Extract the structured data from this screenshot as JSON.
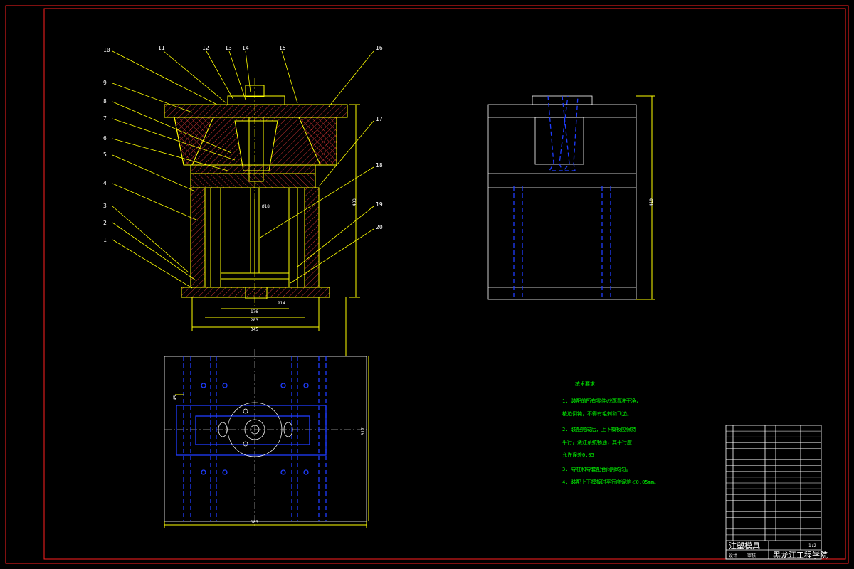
{
  "balloons": [
    "1",
    "2",
    "3",
    "4",
    "5",
    "6",
    "7",
    "8",
    "9",
    "10",
    "11",
    "12",
    "13",
    "14",
    "15",
    "16",
    "17",
    "18",
    "19",
    "20"
  ],
  "front_view": {
    "dims": {
      "height_overall": "403",
      "width_bottom_1": "176",
      "width_bottom_2": "283",
      "width_bottom_3": "345",
      "dia_14": "Ø14",
      "dia_18": "Ø18"
    }
  },
  "side_view": {
    "dims": {
      "height": "410"
    }
  },
  "plan_view": {
    "dims": {
      "width": "385",
      "height": "317",
      "small": "45"
    }
  },
  "tech_requirements": {
    "title": "技术要求",
    "items": [
      "1. 装配前所有零件必须清洗干净，",
      "   棱边倒钝，不得有毛刺和飞边。",
      "2. 装配完成后，上下模板应保持",
      "   平行，浇注系统畅通，其平行度",
      "   允许误差0.05",
      "3. 导柱和导套配合间隙均匀。",
      "4. 装配上下模板时平行度误差＜0.05mm。"
    ]
  },
  "title_block": {
    "drawing_title": "注塑模具",
    "school": "黑龙江工程学院",
    "scale": "1:2",
    "designer": "设计",
    "reviewer": "审核"
  }
}
